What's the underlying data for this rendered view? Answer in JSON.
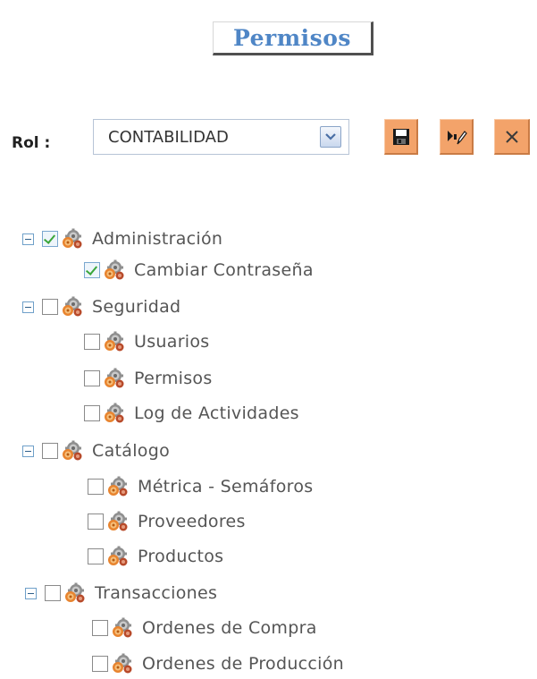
{
  "title": "Permisos",
  "role": {
    "label": "Rol :",
    "selected": "CONTABILIDAD"
  },
  "toolbar": {
    "save_icon": "floppy-disk-icon",
    "edit_icon": "pencil-icon",
    "close_icon": "x-icon"
  },
  "tree": [
    {
      "label": "Administración",
      "checked": true,
      "expanded": true,
      "children": [
        {
          "label": "Cambiar Contraseña",
          "checked": true
        }
      ]
    },
    {
      "label": "Seguridad",
      "checked": false,
      "expanded": true,
      "children": [
        {
          "label": "Usuarios",
          "checked": false
        },
        {
          "label": "Permisos",
          "checked": false
        },
        {
          "label": "Log de Actividades",
          "checked": false
        }
      ]
    },
    {
      "label": "Catálogo",
      "checked": false,
      "expanded": true,
      "children": [
        {
          "label": "Métrica - Semáforos",
          "checked": false
        },
        {
          "label": "Proveedores",
          "checked": false
        },
        {
          "label": "Productos",
          "checked": false
        }
      ]
    },
    {
      "label": "Transacciones",
      "checked": false,
      "expanded": true,
      "children": [
        {
          "label": "Ordenes de Compra",
          "checked": false
        },
        {
          "label": "Ordenes de Producción",
          "checked": false
        }
      ]
    }
  ],
  "colors": {
    "title": "#4f86c6",
    "button": "#f3a36a",
    "check": "#3aa63a"
  }
}
